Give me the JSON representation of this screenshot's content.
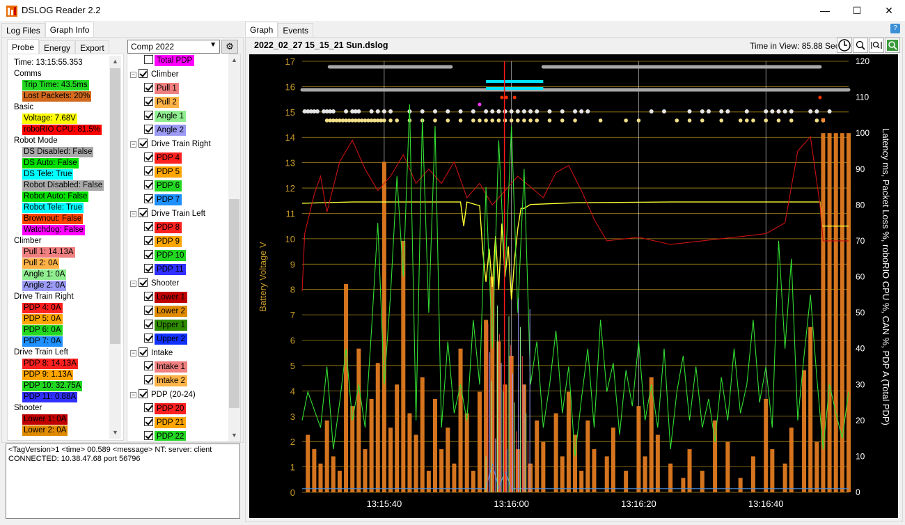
{
  "app": {
    "title": "DSLOG Reader 2.2"
  },
  "window_controls": {
    "minimize": "—",
    "maximize": "☐",
    "close": "✕"
  },
  "left_tabs": [
    "Log Files",
    "Graph Info"
  ],
  "sub_tabs": [
    "Probe",
    "Energy",
    "Export"
  ],
  "probe": {
    "rows": [
      {
        "text": "Time: 13:15:55.353",
        "type": "plain"
      },
      {
        "text": "Comms",
        "type": "header"
      },
      {
        "text": "Trip Time: 43.5ms",
        "bg": "#22d822"
      },
      {
        "text": "Lost Packets: 20%",
        "bg": "#d2691e"
      },
      {
        "text": "Basic",
        "type": "header"
      },
      {
        "text": "Voltage: 7.68V",
        "bg": "#ffff00"
      },
      {
        "text": "roboRIO CPU: 81.5%",
        "bg": "#ff0000"
      },
      {
        "text": "Robot Mode",
        "type": "header"
      },
      {
        "text": "DS Disabled: False",
        "bg": "#a9a9a9"
      },
      {
        "text": "DS Auto: False",
        "bg": "#00e000"
      },
      {
        "text": "DS Tele: True",
        "bg": "#00ffff"
      },
      {
        "text": "Robot Disabled: False",
        "bg": "#a9a9a9"
      },
      {
        "text": "Robot Auto: False",
        "bg": "#00e000"
      },
      {
        "text": "Robot Tele: True",
        "bg": "#00ffff"
      },
      {
        "text": "Brownout: False",
        "bg": "#ff4500"
      },
      {
        "text": "Watchdog: False",
        "bg": "#ff00ff"
      },
      {
        "text": "Climber",
        "type": "header"
      },
      {
        "text": "Pull 1: 14.13A",
        "bg": "#f08080"
      },
      {
        "text": "Pull 2: 0A",
        "bg": "#ffb347"
      },
      {
        "text": "Angle 1: 0A",
        "bg": "#90ee90"
      },
      {
        "text": "Angle 2: 0A",
        "bg": "#9b9bf5"
      },
      {
        "text": "Drive Train Right",
        "type": "header"
      },
      {
        "text": "PDP 4: 0A",
        "bg": "#ff2020"
      },
      {
        "text": "PDP 5: 0A",
        "bg": "#ffa500"
      },
      {
        "text": "PDP 6: 0A",
        "bg": "#22d822"
      },
      {
        "text": "PDP 7: 0A",
        "bg": "#1e90ff"
      },
      {
        "text": "Drive Train Left",
        "type": "header"
      },
      {
        "text": "PDP 8: 14.13A",
        "bg": "#ff2020"
      },
      {
        "text": "PDP 9: 1.13A",
        "bg": "#ffa500"
      },
      {
        "text": "PDP 10: 32.75A",
        "bg": "#22d822"
      },
      {
        "text": "PDP 11: 0.88A",
        "bg": "#3030ff"
      },
      {
        "text": "Shooter",
        "type": "header"
      },
      {
        "text": "Lower 1: 0A",
        "bg": "#c00000"
      },
      {
        "text": "Lower 2: 0A",
        "bg": "#e08a00"
      }
    ]
  },
  "profile": {
    "selected": "Comp 2022"
  },
  "tree": [
    {
      "text": "Total PDP",
      "level": 1,
      "checked": false,
      "bg": "#ff00ff"
    },
    {
      "text": "Climber",
      "level": 0,
      "checked": true
    },
    {
      "text": "Pull 1",
      "level": 1,
      "checked": true,
      "bg": "#f08080"
    },
    {
      "text": "Pull 2",
      "level": 1,
      "checked": true,
      "bg": "#ffb347"
    },
    {
      "text": "Angle 1",
      "level": 1,
      "checked": true,
      "bg": "#90ee90"
    },
    {
      "text": "Angle 2",
      "level": 1,
      "checked": true,
      "bg": "#9b9bf5"
    },
    {
      "text": "Drive Train Right",
      "level": 0,
      "checked": true
    },
    {
      "text": "PDP 4",
      "level": 1,
      "checked": true,
      "bg": "#ff2020"
    },
    {
      "text": "PDP 5",
      "level": 1,
      "checked": true,
      "bg": "#ffa500"
    },
    {
      "text": "PDP 6",
      "level": 1,
      "checked": true,
      "bg": "#22d822"
    },
    {
      "text": "PDP 7",
      "level": 1,
      "checked": true,
      "bg": "#1e90ff"
    },
    {
      "text": "Drive Train Left",
      "level": 0,
      "checked": true
    },
    {
      "text": "PDP 8",
      "level": 1,
      "checked": true,
      "bg": "#ff2020"
    },
    {
      "text": "PDP 9",
      "level": 1,
      "checked": true,
      "bg": "#ffa500"
    },
    {
      "text": "PDP 10",
      "level": 1,
      "checked": true,
      "bg": "#22d822"
    },
    {
      "text": "PDP 11",
      "level": 1,
      "checked": true,
      "bg": "#3030ff"
    },
    {
      "text": "Shooter",
      "level": 0,
      "checked": true
    },
    {
      "text": "Lower 1",
      "level": 1,
      "checked": true,
      "bg": "#c00000"
    },
    {
      "text": "Lower 2",
      "level": 1,
      "checked": true,
      "bg": "#e08a00"
    },
    {
      "text": "Upper 1",
      "level": 1,
      "checked": true,
      "bg": "#2e8b00"
    },
    {
      "text": "Upper 2",
      "level": 1,
      "checked": true,
      "bg": "#1030ff"
    },
    {
      "text": "Intake",
      "level": 0,
      "checked": true
    },
    {
      "text": "Intake 1",
      "level": 1,
      "checked": true,
      "bg": "#f08080"
    },
    {
      "text": "Intake 2",
      "level": 1,
      "checked": true,
      "bg": "#ffb347"
    },
    {
      "text": "PDP (20-24)",
      "level": 0,
      "checked": true
    },
    {
      "text": "PDP 20",
      "level": 1,
      "checked": true,
      "bg": "#ff2020"
    },
    {
      "text": "PDP 21",
      "level": 1,
      "checked": true,
      "bg": "#ffa500"
    },
    {
      "text": "PDP 22",
      "level": 1,
      "checked": true,
      "bg": "#22d822"
    }
  ],
  "console": {
    "lines": [
      "<TagVersion>1 <time> 00.589 <message> NT: server: client",
      "CONNECTED: 10.38.47.68 port 56796"
    ]
  },
  "right_tabs": [
    "Graph",
    "Events"
  ],
  "graph": {
    "filename": "2022_02_27 15_15_21 Sun.dslog",
    "time_in_view": "Time in View: 85.88 Sec"
  },
  "chart_data": {
    "type": "line",
    "ylabel": "Battery Voltage V",
    "y2label": "Latency ms, Packet Loss %, roboRIO CPU %, CAN %, PDP A (Total PDP)",
    "ylim": [
      0,
      17
    ],
    "y2lim": [
      0,
      120
    ],
    "y_ticks": [
      "0",
      "1",
      "2",
      "3",
      "4",
      "5",
      "6",
      "7",
      "8",
      "9",
      "10",
      "11",
      "12",
      "13",
      "14",
      "15",
      "16",
      "17"
    ],
    "y2_ticks": [
      "0",
      "10",
      "20",
      "30",
      "40",
      "50",
      "60",
      "70",
      "80",
      "90",
      "100",
      "110",
      "120"
    ],
    "x_ticks": [
      "13:15:40",
      "13:16:00",
      "13:16:20",
      "13:16:40"
    ],
    "x_range_seconds": [
      -12.9,
      73.0
    ],
    "colors": {
      "voltage": "#ffff33",
      "cpu": "#cc1111",
      "trip": "#33dd33",
      "pdp": "#e07a20",
      "can": "#4a8fe0",
      "grid": "#c8a020"
    },
    "series": [
      {
        "key": "voltage",
        "axis": "left",
        "points": [
          [
            -12.9,
            11.4
          ],
          [
            -5,
            11.45
          ],
          [
            5,
            11.45
          ],
          [
            11,
            11.45
          ],
          [
            12,
            11.45
          ],
          [
            12.5,
            10.5
          ],
          [
            13,
            11.45
          ],
          [
            15,
            11.3
          ],
          [
            15.5,
            9.5
          ],
          [
            16,
            8.3
          ],
          [
            16.5,
            9.6
          ],
          [
            17,
            8.1
          ],
          [
            17.5,
            10.1
          ],
          [
            18,
            8.0
          ],
          [
            18.5,
            10.6
          ],
          [
            19,
            8.5
          ],
          [
            19.5,
            9.7
          ],
          [
            20,
            7.6
          ],
          [
            20.5,
            9.2
          ],
          [
            21,
            10.4
          ],
          [
            21.5,
            11.2
          ],
          [
            22,
            11.2
          ],
          [
            23,
            11.35
          ],
          [
            30,
            11.42
          ],
          [
            45,
            11.45
          ],
          [
            60,
            11.45
          ],
          [
            68.5,
            11.45
          ],
          [
            68.8,
            10.5
          ],
          [
            73,
            10.5
          ]
        ]
      },
      {
        "key": "cpu",
        "axis": "right",
        "points": [
          [
            -12.9,
            56
          ],
          [
            -12.5,
            72
          ],
          [
            -11,
            83
          ],
          [
            -10,
            88
          ],
          [
            -9,
            78
          ],
          [
            -7,
            92
          ],
          [
            -5,
            98
          ],
          [
            -3,
            90
          ],
          [
            -1,
            84
          ],
          [
            1,
            88
          ],
          [
            3,
            94
          ],
          [
            5,
            86
          ],
          [
            7,
            90
          ],
          [
            9,
            86
          ],
          [
            11,
            92
          ],
          [
            13,
            82
          ],
          [
            15,
            86
          ],
          [
            17,
            80
          ],
          [
            19,
            84
          ],
          [
            21,
            88
          ],
          [
            23,
            85
          ],
          [
            25,
            82
          ],
          [
            27,
            89
          ],
          [
            29,
            91
          ],
          [
            31,
            84
          ],
          [
            33,
            76
          ],
          [
            35,
            70
          ],
          [
            40,
            71
          ],
          [
            45,
            69
          ],
          [
            50,
            70
          ],
          [
            55,
            71
          ],
          [
            60,
            72
          ],
          [
            63,
            75
          ],
          [
            65,
            95
          ],
          [
            67,
            99
          ],
          [
            68.5,
            80
          ],
          [
            69,
            70
          ],
          [
            73,
            70
          ]
        ]
      },
      {
        "key": "trip",
        "axis": "right",
        "points": [
          [
            -12.9,
            20
          ],
          [
            -12,
            28
          ],
          [
            -10,
            18
          ],
          [
            -9,
            35
          ],
          [
            -8,
            12
          ],
          [
            -7,
            25
          ],
          [
            -6,
            40
          ],
          [
            -5,
            20
          ],
          [
            -4,
            30
          ],
          [
            -3,
            18
          ],
          [
            -2,
            45
          ],
          [
            -1,
            75
          ],
          [
            0,
            30
          ],
          [
            1,
            55
          ],
          [
            2,
            88
          ],
          [
            3,
            60
          ],
          [
            4,
            108
          ],
          [
            5,
            20
          ],
          [
            6,
            104
          ],
          [
            7,
            50
          ],
          [
            8,
            102
          ],
          [
            9,
            18
          ],
          [
            10,
            42
          ],
          [
            11,
            22
          ],
          [
            12,
            30
          ],
          [
            13,
            20
          ],
          [
            14,
            48
          ],
          [
            15,
            30
          ],
          [
            16,
            85
          ],
          [
            17,
            40
          ],
          [
            18,
            98
          ],
          [
            19,
            60
          ],
          [
            20,
            102
          ],
          [
            21,
            50
          ],
          [
            22,
            90
          ],
          [
            23,
            30
          ],
          [
            24,
            42
          ],
          [
            25,
            18
          ],
          [
            26,
            30
          ],
          [
            27,
            45
          ],
          [
            28,
            22
          ],
          [
            29,
            35
          ],
          [
            30,
            10
          ],
          [
            31,
            26
          ],
          [
            32,
            40
          ],
          [
            33,
            18
          ],
          [
            34,
            48
          ],
          [
            35,
            28
          ],
          [
            36,
            36
          ],
          [
            37,
            16
          ],
          [
            38,
            34
          ],
          [
            39,
            24
          ],
          [
            40,
            42
          ],
          [
            41,
            20
          ],
          [
            42,
            30
          ],
          [
            43,
            18
          ],
          [
            44,
            40
          ],
          [
            45,
            12
          ],
          [
            46,
            28
          ],
          [
            47,
            38
          ],
          [
            48,
            20
          ],
          [
            49,
            35
          ],
          [
            50,
            18
          ],
          [
            51,
            26
          ],
          [
            52,
            14
          ],
          [
            53,
            32
          ],
          [
            54,
            20
          ],
          [
            55,
            40
          ],
          [
            56,
            22
          ],
          [
            57,
            30
          ],
          [
            58,
            48
          ],
          [
            59,
            25
          ],
          [
            60,
            35
          ],
          [
            61,
            18
          ],
          [
            62,
            70
          ],
          [
            63,
            40
          ],
          [
            64,
            65
          ],
          [
            65,
            20
          ],
          [
            66,
            38
          ],
          [
            67,
            55
          ],
          [
            68,
            32
          ],
          [
            69,
            12
          ],
          [
            70,
            30
          ],
          [
            71,
            22
          ],
          [
            72,
            15
          ],
          [
            73,
            28
          ]
        ]
      },
      {
        "key": "can",
        "axis": "right",
        "points": [
          [
            -12.9,
            1
          ],
          [
            0,
            1
          ],
          [
            16,
            1
          ],
          [
            17,
            8
          ],
          [
            18,
            1
          ],
          [
            19,
            6
          ],
          [
            20,
            1
          ],
          [
            73,
            1
          ]
        ]
      }
    ],
    "pdp_bars": [
      [
        -12,
        16
      ],
      [
        -11,
        12
      ],
      [
        -10,
        8
      ],
      [
        -9,
        20
      ],
      [
        -8,
        10
      ],
      [
        -7,
        6
      ],
      [
        -6,
        58
      ],
      [
        -5,
        24
      ],
      [
        -4,
        40
      ],
      [
        -3,
        12
      ],
      [
        -2,
        26
      ],
      [
        -1,
        36
      ],
      [
        0,
        92
      ],
      [
        1,
        18
      ],
      [
        2,
        30
      ],
      [
        3,
        70
      ],
      [
        4,
        22
      ],
      [
        5,
        16
      ],
      [
        6,
        32
      ],
      [
        7,
        6
      ],
      [
        8,
        26
      ],
      [
        9,
        12
      ],
      [
        10,
        18
      ],
      [
        11,
        8
      ],
      [
        12,
        40
      ],
      [
        13,
        22
      ],
      [
        14,
        6
      ],
      [
        15,
        28
      ],
      [
        16,
        48
      ],
      [
        17,
        60
      ],
      [
        18,
        42
      ],
      [
        19,
        30
      ],
      [
        20,
        38
      ],
      [
        21,
        12
      ],
      [
        22,
        30
      ],
      [
        23,
        8
      ],
      [
        24,
        20
      ],
      [
        25,
        14
      ],
      [
        27,
        22
      ],
      [
        28,
        10
      ],
      [
        29,
        28
      ],
      [
        30,
        16
      ],
      [
        31,
        6
      ],
      [
        32,
        20
      ],
      [
        33,
        12
      ],
      [
        35,
        10
      ],
      [
        36,
        18
      ],
      [
        38,
        6
      ],
      [
        40,
        24
      ],
      [
        41,
        10
      ],
      [
        42,
        32
      ],
      [
        43,
        16
      ],
      [
        45,
        8
      ],
      [
        47,
        4
      ],
      [
        48,
        12
      ],
      [
        50,
        6
      ],
      [
        52,
        20
      ],
      [
        54,
        14
      ],
      [
        56,
        4
      ],
      [
        58,
        10
      ],
      [
        60,
        26
      ],
      [
        61,
        12
      ],
      [
        63,
        8
      ],
      [
        64,
        18
      ],
      [
        66,
        34
      ],
      [
        67,
        46
      ],
      [
        68,
        14
      ],
      [
        69,
        100
      ],
      [
        70,
        100
      ],
      [
        71,
        100
      ],
      [
        72,
        100
      ],
      [
        73,
        100
      ]
    ]
  }
}
